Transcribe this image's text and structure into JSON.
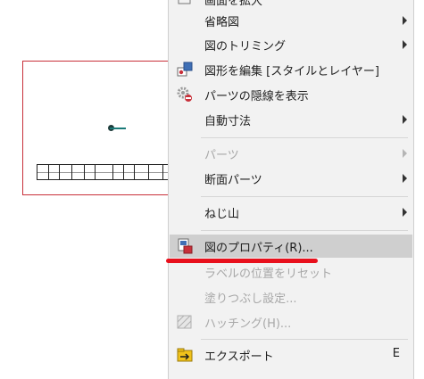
{
  "menu": {
    "items": [
      {
        "label": "画面を拡大",
        "disabled": false,
        "submenu": false
      },
      {
        "label": "省略図",
        "disabled": false,
        "submenu": true
      },
      {
        "label": "図のトリミング",
        "disabled": false,
        "submenu": true
      },
      {
        "label": "図形を編集 [スタイルとレイヤー]",
        "disabled": false,
        "submenu": false
      },
      {
        "label": "パーツの隠線を表示",
        "disabled": false,
        "submenu": false
      },
      {
        "label": "自動寸法",
        "disabled": false,
        "submenu": true
      },
      {
        "label": "パーツ",
        "disabled": true,
        "submenu": true
      },
      {
        "label": "断面パーツ",
        "disabled": false,
        "submenu": true
      },
      {
        "label": "ねじ山",
        "disabled": false,
        "submenu": true
      },
      {
        "label": "図のプロパティ(R)...",
        "disabled": false,
        "submenu": false,
        "highlighted": true
      },
      {
        "label": "ラベルの位置をリセット",
        "disabled": true,
        "submenu": false
      },
      {
        "label": "塗りつぶし設定...",
        "disabled": true,
        "submenu": false
      },
      {
        "label": "ハッチング(H)...",
        "disabled": true,
        "submenu": false
      },
      {
        "label": "エクスポート",
        "disabled": false,
        "submenu": false,
        "shortcut": "E"
      }
    ]
  },
  "colors": {
    "annotation_underline": "#e8101c",
    "highlight_bg": "#cfcfcf",
    "sheet_border": "#c8303a"
  },
  "icons": {
    "edit_shape": "edit-shape-icon",
    "hidden_lines": "hidden-lines-gear-icon",
    "drawing_properties": "drawing-properties-icon",
    "hatching": "hatching-icon",
    "export": "export-folder-icon"
  }
}
